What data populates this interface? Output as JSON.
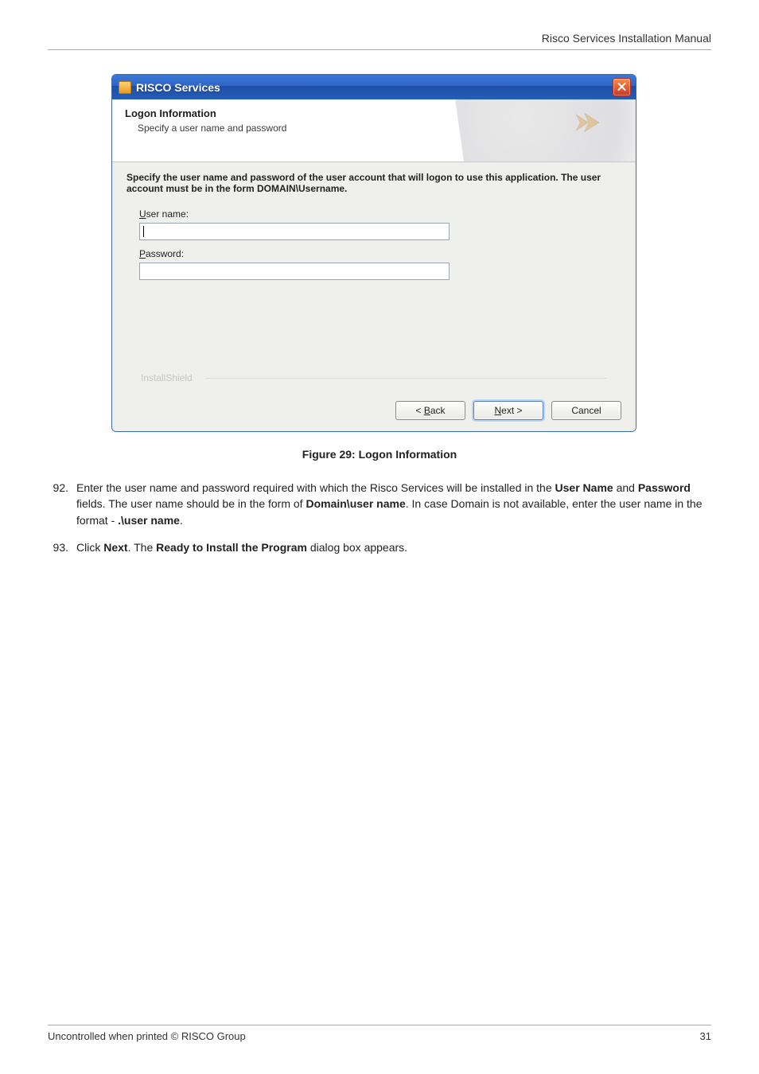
{
  "header": {
    "doc_title": "Risco Services Installation Manual"
  },
  "dialog": {
    "window_title": "RISCO Services",
    "banner_title": "Logon Information",
    "banner_sub": "Specify a user name and password",
    "instruction": "Specify the user name and password of the user account that will logon to use this application. The user account must be in the form DOMAIN\\Username.",
    "user_label": "User name:",
    "user_value": "",
    "pass_label": "Password:",
    "pass_value": "",
    "brand": "InstallShield",
    "btn_back": "< Back",
    "btn_next": "Next >",
    "btn_cancel": "Cancel"
  },
  "caption": "Figure 29: Logon Information",
  "steps": [
    {
      "num": "92.",
      "text_pre": "Enter the user name and password required with which the Risco Services will be installed in the ",
      "bold1": "User Name",
      "mid1": " and ",
      "bold2": "Password",
      "mid2": " fields. The user name should be in the form of ",
      "bold3": "Domain\\user name",
      "mid3": ". In case Domain is not available, enter the user name in the format - ",
      "bold4": ".\\user name",
      "tail": "."
    },
    {
      "num": "93.",
      "text_pre": "Click ",
      "bold1": "Next",
      "mid1": ". The ",
      "bold2": "Ready to Install the Program",
      "mid2": " dialog box appears.",
      "bold3": "",
      "mid3": "",
      "bold4": "",
      "tail": ""
    }
  ],
  "footer": {
    "left": "Uncontrolled when printed © RISCO Group",
    "right": "31"
  }
}
